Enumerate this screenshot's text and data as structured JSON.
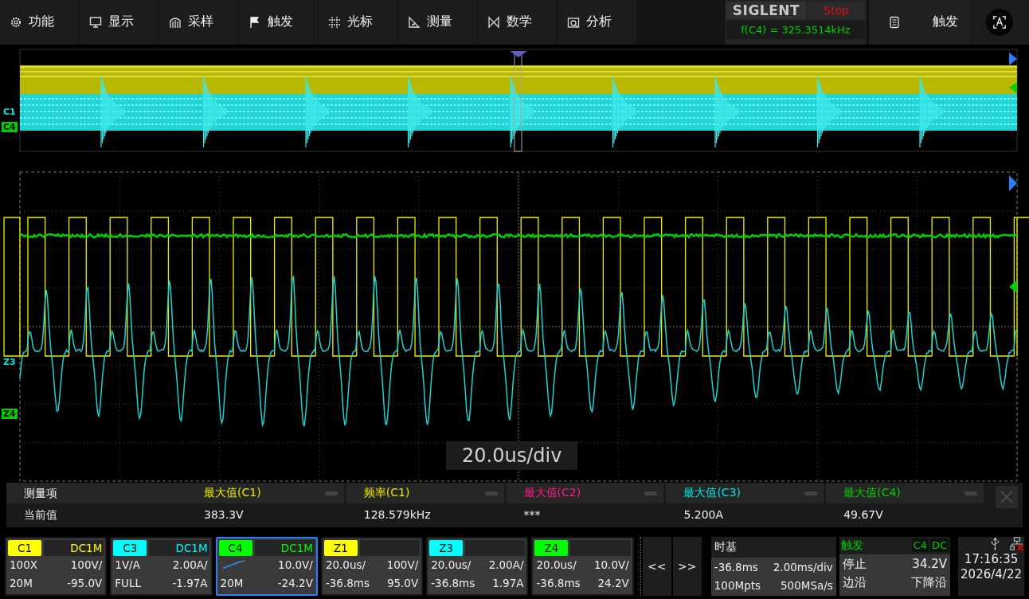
{
  "menu": [
    {
      "label": "功能"
    },
    {
      "label": "显示"
    },
    {
      "label": "采样"
    },
    {
      "label": "触发"
    },
    {
      "label": "光标"
    },
    {
      "label": "测量"
    },
    {
      "label": "数学"
    },
    {
      "label": "分析"
    }
  ],
  "brand": "SIGLENT",
  "run_state": "Stop",
  "freq_readout": "f(C4) = 325.3514kHz",
  "side_menu": "触发",
  "overview_markers": [
    {
      "label": "C1",
      "color": "#00e5e5",
      "kind": "text"
    },
    {
      "label": "C4",
      "color": "#00d000",
      "kind": "box"
    }
  ],
  "main_markers": [
    {
      "label": "Z3",
      "color": "#00e5e5",
      "kind": "text"
    },
    {
      "label": "Z4",
      "color": "#00d000",
      "kind": "box"
    }
  ],
  "timebase_label": "20.0us/div",
  "measure": {
    "header": "测量项",
    "row_label": "当前值",
    "items": [
      {
        "label": "最大值(C1)",
        "value": "383.3V",
        "color": "#e8e800"
      },
      {
        "label": "频率(C1)",
        "value": "128.579kHz",
        "color": "#e8e800"
      },
      {
        "label": "最大值(C2)",
        "value": "***",
        "color": "#ff1a8c"
      },
      {
        "label": "最大值(C3)",
        "value": "5.200A",
        "color": "#00e5e5"
      },
      {
        "label": "最大值(C4)",
        "value": "49.67V",
        "color": "#00d000"
      }
    ]
  },
  "channels": [
    {
      "name": "C1",
      "color": "#ffff00",
      "coupling": "DC1M",
      "kind": "text",
      "r1_left": "100X",
      "r1_right": "100V/",
      "r2_left": "20M",
      "r2_right": "-95.0V",
      "selected": false
    },
    {
      "name": "C3",
      "color": "#00ffff",
      "coupling": "DC1M",
      "kind": "text",
      "r1_left": "1V/A",
      "r1_right": "2.00A/",
      "r2_left": "FULL",
      "r2_right": "-1.97A",
      "selected": false
    },
    {
      "name": "C4",
      "color": "#00ff00",
      "coupling": "DC1M",
      "kind": "probe",
      "r1_right": "10.0V/",
      "r2_left": "20M",
      "r2_right": "-24.2V",
      "selected": true
    },
    {
      "name": "Z1",
      "color": "#ffff00",
      "kind": "text",
      "r1_left": "20.0us/",
      "r1_right": "100V/",
      "r2_left": "-36.8ms",
      "r2_right": "95.0V",
      "selected": false
    },
    {
      "name": "Z3",
      "color": "#00ffff",
      "kind": "text",
      "r1_left": "20.0us/",
      "r1_right": "2.00A/",
      "r2_left": "-36.8ms",
      "r2_right": "1.97A",
      "selected": false
    },
    {
      "name": "Z4",
      "color": "#00ff00",
      "kind": "text",
      "r1_left": "20.0us/",
      "r1_right": "10.0V/",
      "r2_left": "-36.8ms",
      "r2_right": "24.2V",
      "selected": false
    }
  ],
  "nav": [
    "<<",
    ">>"
  ],
  "timebase": {
    "title": "时基",
    "r1_left": "-36.8ms",
    "r1_right": "2.00ms/div",
    "r2_left": "100Mpts",
    "r2_right": "500MSa/s"
  },
  "trigger": {
    "title": "触发",
    "source": "C4",
    "coupling": "DC",
    "r1_left": "停止",
    "r1_right": "34.2V",
    "r2_left": "边沿",
    "r2_right": "下降沿"
  },
  "clock": {
    "time": "17:16:35",
    "date": "2026/4/22"
  }
}
